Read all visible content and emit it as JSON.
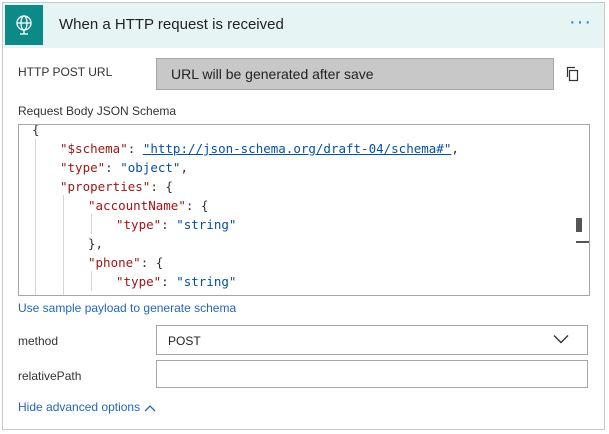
{
  "header": {
    "title": "When a HTTP request is received",
    "more_label": "···",
    "icon": "request-globe-icon",
    "icon_bg": "#0b8a87"
  },
  "http_post_url": {
    "label": "HTTP POST URL",
    "value": "URL will be generated after save",
    "copy_icon": "copy-icon"
  },
  "schema": {
    "label": "Request Body JSON Schema",
    "lines": [
      {
        "open": "{",
        "key": "",
        "colon": "",
        "value": "",
        "value_class": "",
        "close": ""
      },
      {
        "open": "\"",
        "key": "$schema",
        "colon": "\": ",
        "value": "\"http://json-schema.org/draft-04/schema#\"",
        "value_class": "link",
        "close": ","
      },
      {
        "open": "\"",
        "key": "type",
        "colon": "\": ",
        "value": "\"object\"",
        "value_class": "str",
        "close": ","
      },
      {
        "open": "\"",
        "key": "properties",
        "colon": "\": ",
        "value": "",
        "value_class": "",
        "close": "{"
      },
      {
        "open": "\"",
        "key": "accountName",
        "colon": "\": ",
        "value": "",
        "value_class": "",
        "close": "{"
      },
      {
        "open": "\"",
        "key": "type",
        "colon": "\": ",
        "value": "\"string\"",
        "value_class": "str",
        "close": ""
      },
      {
        "open": "},",
        "key": "",
        "colon": "",
        "value": "",
        "value_class": "",
        "close": ""
      },
      {
        "open": "\"",
        "key": "phone",
        "colon": "\": ",
        "value": "",
        "value_class": "",
        "close": "{"
      },
      {
        "open": "\"",
        "key": "type",
        "colon": "\": ",
        "value": "\"string\"",
        "value_class": "str",
        "close": ""
      },
      {
        "open": "},",
        "key": "",
        "colon": "",
        "value": "",
        "value_class": "",
        "close": ""
      }
    ]
  },
  "sample_link": "Use sample payload to generate schema",
  "method": {
    "label": "method",
    "value": "POST",
    "chevron_icon": "chevron-down-icon"
  },
  "relative_path": {
    "label": "relativePath",
    "value": ""
  },
  "advanced": {
    "label": "Hide advanced options",
    "chevron_icon": "chevron-up-icon"
  },
  "colors": {
    "accent": "#0b8a87",
    "header_bg": "#e6f4f4",
    "link": "#2266c4",
    "json_key": "#a31515",
    "json_string": "#0451a5"
  }
}
